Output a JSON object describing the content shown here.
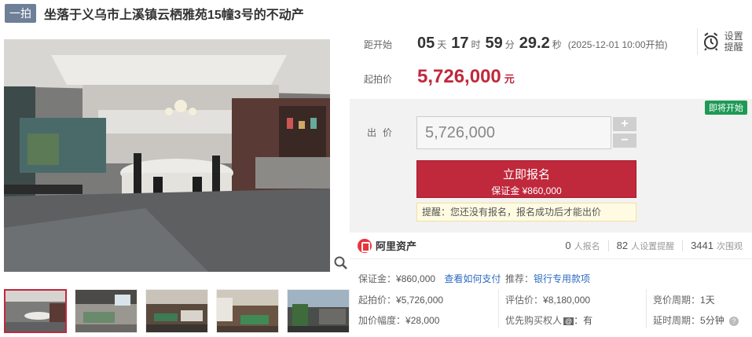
{
  "header": {
    "tag": "一拍",
    "title": "坐落于义乌市上溪镇云栖雅苑15幢3号的不动产"
  },
  "countdown": {
    "label": "距开始",
    "days": "05",
    "days_unit": "天",
    "hours": "17",
    "hours_unit": "时",
    "minutes": "59",
    "minutes_unit": "分",
    "seconds": "29.2",
    "seconds_unit": "秒",
    "start_note": "(2025-12-01 10:00开拍)"
  },
  "remind": {
    "label_1": "设置",
    "label_2": "提醒",
    "icon": "alarm-clock-icon"
  },
  "start_price": {
    "label": "起拍价",
    "value": "5,726,000",
    "unit": "元"
  },
  "bid": {
    "status_badge": "即将开始",
    "label": "出价",
    "input_value": "5,726,000",
    "plus": "+",
    "minus": "−",
    "signup_label": "立即报名",
    "deposit_text": "保证金 ¥860,000",
    "notice": "提醒：您还没有报名，报名成功后才能出价"
  },
  "platform": {
    "name": "阿里资产"
  },
  "stats": {
    "signups": "0",
    "signups_label": "人报名",
    "reminders": "82",
    "reminders_label": "人设置提醒",
    "views": "3441",
    "views_label": "次围观"
  },
  "details": {
    "deposit_label": "保证金：",
    "deposit_value": "¥860,000",
    "how_to_pay": "查看如何支付",
    "recommend_label": "推荐：",
    "recommend_link": "银行专用款项",
    "start_label": "起拍价：",
    "start_value": "¥5,726,000",
    "appraisal_label": "评估价：",
    "appraisal_value": "¥8,180,000",
    "cycle_label": "竞价周期：",
    "cycle_value": "1天",
    "increment_label": "加价幅度：",
    "increment_value": "¥28,000",
    "priority_label": "优先购买权人",
    "priority_tag": "@",
    "priority_value": "：有",
    "extend_label": "延时周期：",
    "extend_value": "5分钟"
  },
  "colors": {
    "accent_red": "#c0283c",
    "badge_green": "#1e9a55",
    "tag_blue_gray": "#6e7f98",
    "link_blue": "#2d6cc2"
  }
}
